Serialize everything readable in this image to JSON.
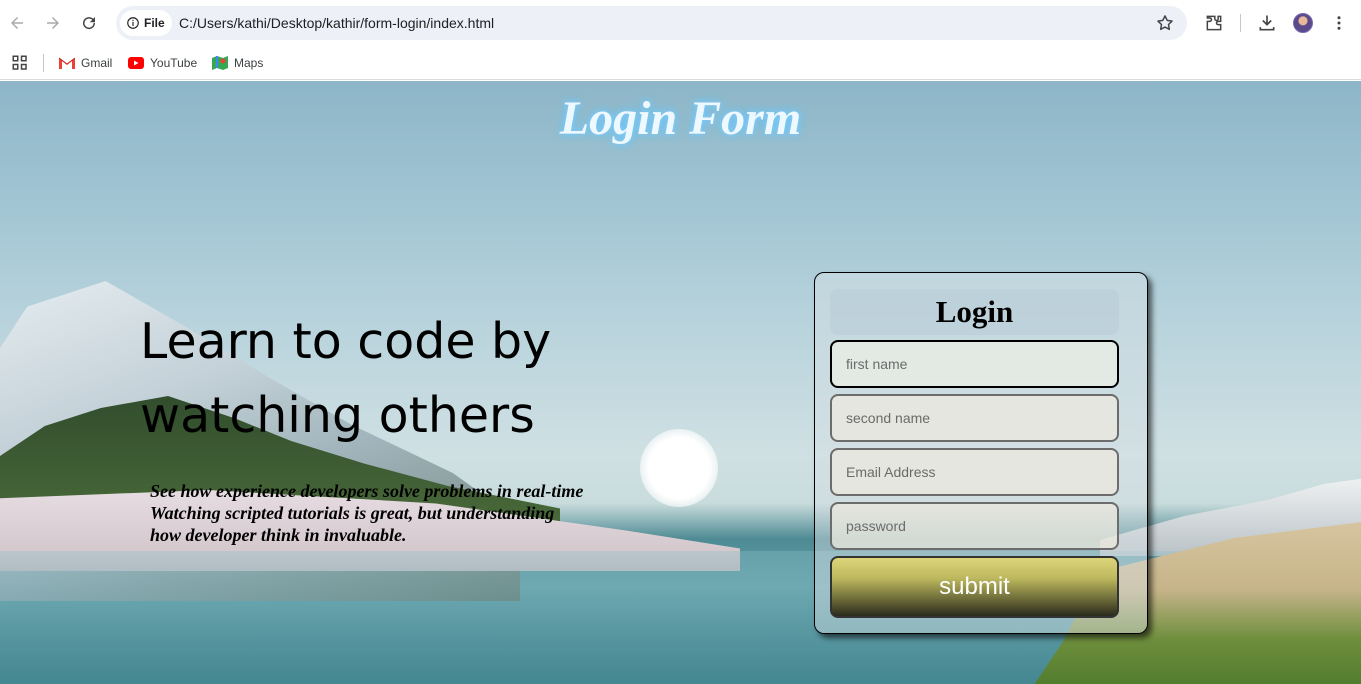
{
  "browser": {
    "scheme_label": "File",
    "url": "C:/Users/kathi/Desktop/kathir/form-login/index.html"
  },
  "bookmarks": [
    {
      "label": "Gmail",
      "icon": "gmail-icon"
    },
    {
      "label": "YouTube",
      "icon": "youtube-icon"
    },
    {
      "label": "Maps",
      "icon": "maps-icon"
    }
  ],
  "page": {
    "title": "Login Form",
    "hero_line1": "Learn to code by",
    "hero_line2": "watching others",
    "description": [
      "See how experience developers solve problems in real-time",
      "Watching scripted tutorials is great, but understanding",
      "how developer think in invaluable."
    ]
  },
  "login": {
    "heading": "Login",
    "first_name_placeholder": "first name",
    "second_name_placeholder": "second name",
    "email_placeholder": "Email Address",
    "password_placeholder": "password",
    "submit_label": "submit"
  },
  "colors": {
    "title_glow": "#5cc0ff",
    "submit_top": "#ddd57a",
    "submit_bottom": "#2a2a1c"
  }
}
